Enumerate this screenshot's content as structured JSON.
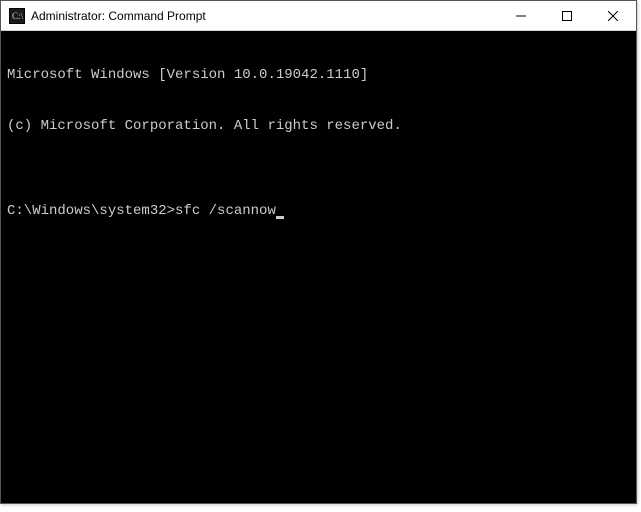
{
  "window": {
    "title": "Administrator: Command Prompt",
    "icon_name": "cmd-prompt-icon"
  },
  "terminal": {
    "lines": [
      "Microsoft Windows [Version 10.0.19042.1110]",
      "(c) Microsoft Corporation. All rights reserved.",
      ""
    ],
    "prompt": "C:\\Windows\\system32>",
    "command": "sfc /scannow"
  },
  "colors": {
    "terminal_bg": "#000000",
    "terminal_fg": "#cccccc",
    "titlebar_bg": "#ffffff"
  }
}
